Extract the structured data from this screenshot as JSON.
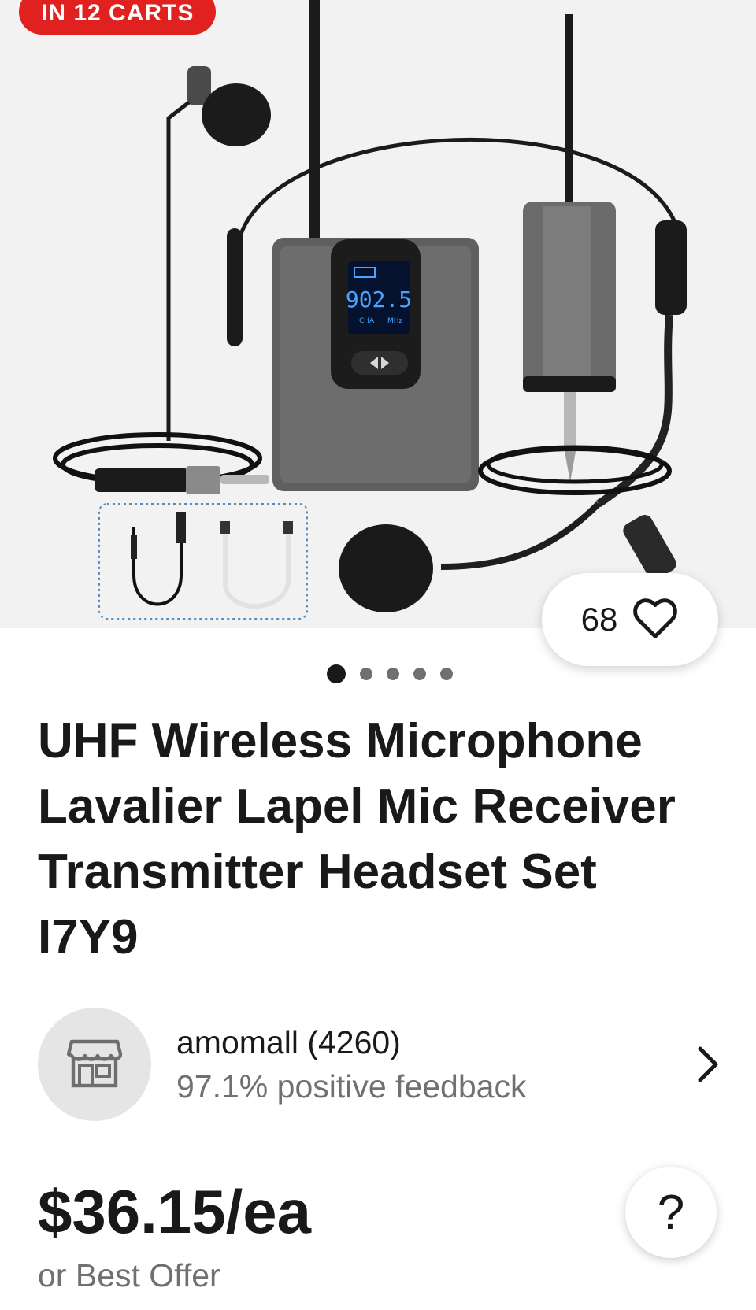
{
  "badge": {
    "label": "IN 12 CARTS"
  },
  "product_image": {
    "display_frequency": "902.5",
    "display_channel": "CHA",
    "display_unit": "MHz"
  },
  "watch": {
    "count": "68",
    "icon": "heart-outline-icon"
  },
  "carousel": {
    "total": 5,
    "active_index": 0
  },
  "listing": {
    "title": "UHF Wireless Microphone Lavalier Lapel Mic Receiver Transmitter Headset Set I7Y9"
  },
  "seller": {
    "name": "amomall (4260)",
    "feedback": "97.1% positive feedback",
    "icon": "store-icon"
  },
  "pricing": {
    "price": "$36.15/ea",
    "offer_text": "or Best Offer"
  },
  "help": {
    "label": "?"
  },
  "colors": {
    "badge_red": "#e0211f",
    "text_dark": "#191919",
    "text_muted": "#707070"
  }
}
